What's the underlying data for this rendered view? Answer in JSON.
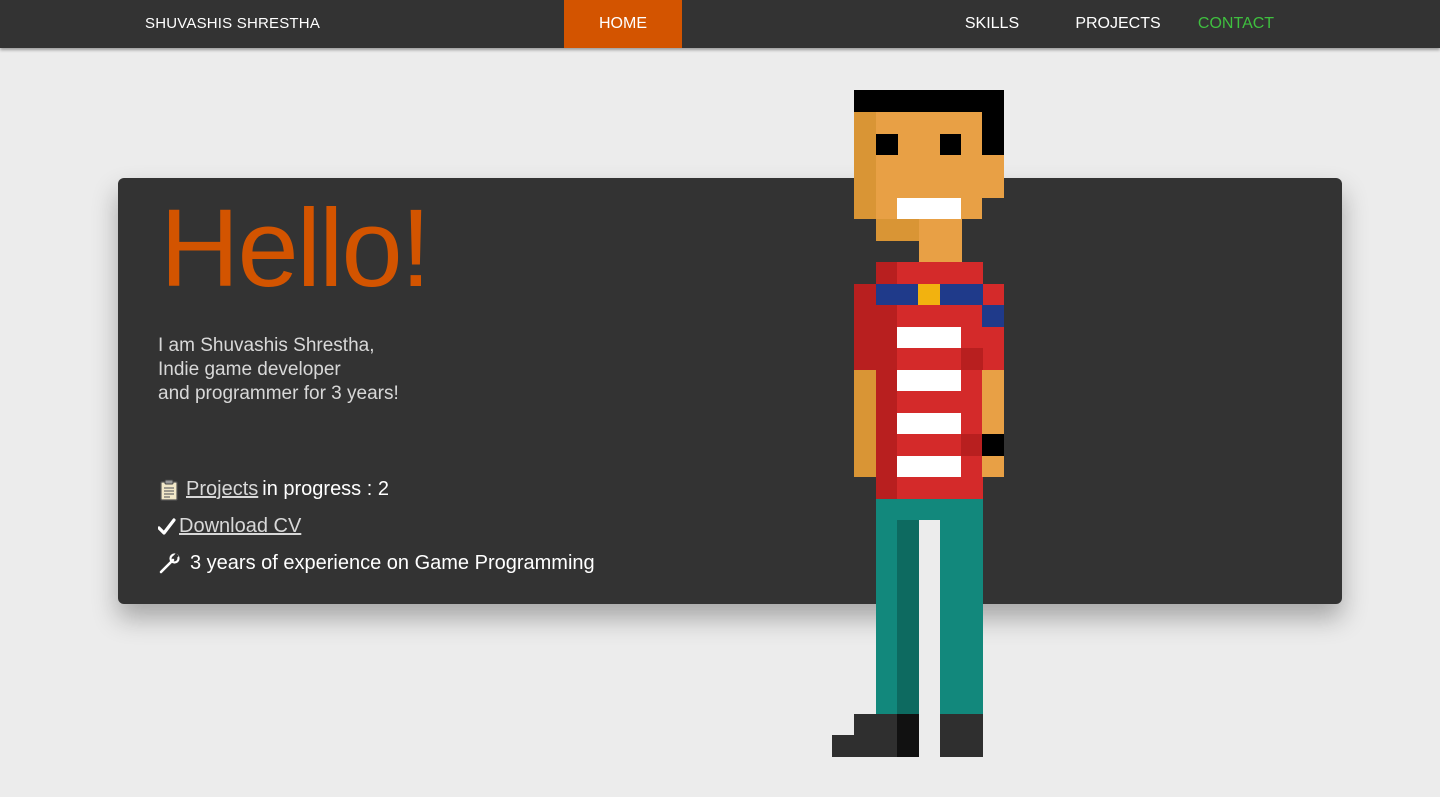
{
  "nav": {
    "brand": "SHUVASHIS SHRESTHA",
    "items": [
      {
        "label": "HOME",
        "active": true
      },
      {
        "label": "SKILLS"
      },
      {
        "label": "PROJECTS"
      },
      {
        "label": "CONTACT",
        "color": "#3fbf3f"
      }
    ]
  },
  "hero": {
    "title": "Hello!",
    "intro": [
      "I am Shuvashis Shrestha,",
      "Indie game developer",
      "and programmer for 3 years!"
    ],
    "facts": {
      "projects": {
        "icon": "clipboard-icon",
        "link": "Projects",
        "text": "in progress : 2"
      },
      "cv": {
        "icon": "checkmark-icon",
        "link": "Download CV"
      },
      "experience": {
        "icon": "wrench-icon",
        "text": "3 years of experience on Game Programming"
      }
    }
  },
  "colors": {
    "accent": "#d35400",
    "navbar": "#333333",
    "card": "#333333",
    "background": "#ececec",
    "contact": "#3fbf3f"
  }
}
